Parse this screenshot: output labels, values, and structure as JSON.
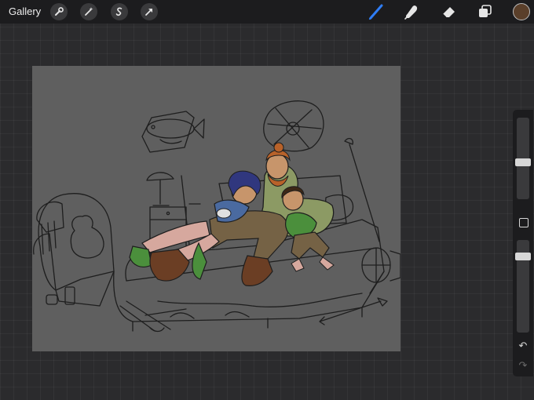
{
  "toolbar": {
    "gallery_label": "Gallery",
    "left_tools": [
      "wrench-icon",
      "magic-wand-icon",
      "selection-icon",
      "transform-arrow-icon"
    ],
    "right_tools": [
      "brush-icon",
      "smudge-icon",
      "eraser-icon",
      "layers-icon"
    ],
    "active_tool": "brush-icon",
    "current_color": "#5a3f2a",
    "brush_color": "#2f7df6"
  },
  "sidebar": {
    "brush_size_level": 0.45,
    "brush_opacity_level": 0.15,
    "undo_icon": "undo-icon",
    "redo_icon": "redo-icon"
  },
  "canvas": {
    "background": "#5f5f5f",
    "artwork": "illustration-of-family-on-bed"
  }
}
